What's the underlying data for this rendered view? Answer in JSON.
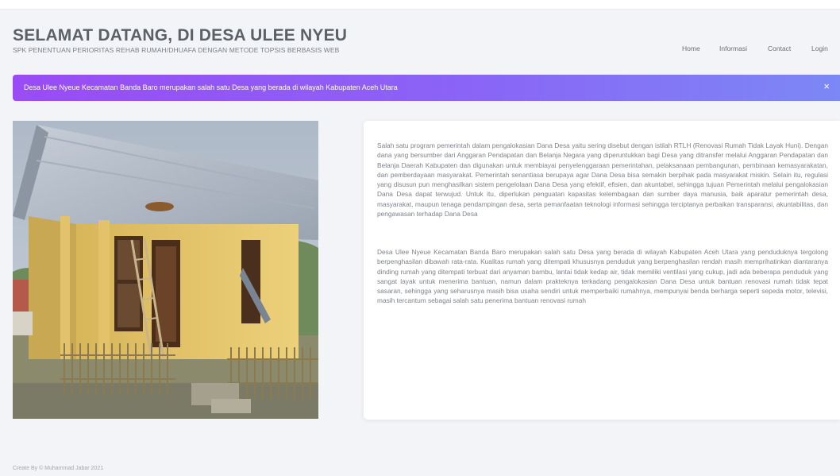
{
  "header": {
    "title": "SELAMAT DATANG, DI DESA ULEE NYEU",
    "subtitle": "SPK PENENTUAN PERIORITAS REHAB RUMAH/DHUAFA DENGAN METODE TOPSIS BERBASIS WEB"
  },
  "nav": {
    "home": "Home",
    "informasi": "Informasi",
    "contact": "Contact",
    "login": "Login"
  },
  "alert": {
    "text": "Desa Ulee Nyeue Kecamatan Banda Baro merupakan salah satu Desa yang berada di wilayah Kabupaten Aceh Utara",
    "close": "×",
    "gradient_start": "#9a4bf5",
    "gradient_end": "#7c88f5"
  },
  "photo": {
    "subject": "rehab house photo",
    "wall_color": "#e6c66a",
    "roof_color": "#b7bfc9"
  },
  "content": {
    "paragraph1": "Salah satu program pemerintah dalam pengalokasian Dana Desa yaitu sering disebut dengan istilah RTLH (Renovasi Rumah Tidak Layak Huni). Dengan dana yang bersumber dari Anggaran Pendapatan dan Belanja Negara yang diperuntukkan bagi Desa yang ditransfer melalui Anggaran Pendapatan dan Belanja Daerah Kabupaten dan digunakan untuk membiayai penyelenggaraan pemerintahan, pelaksanaan pembangunan, pembinaan kemasyarakatan, dan pemberdayaan masyarakat. Pemerintah senantiasa berupaya agar Dana Desa bisa semakin berpihak pada masyarakat miskin. Selain itu, regulasi yang disusun pun menghasilkan sistem pengelolaan Dana Desa yang efektif, efisien, dan akuntabel, sehingga tujuan Pemerintah melalui pengalokasian Dana Desa dapat terwujud. Untuk itu, diperlukan penguatan kapasitas kelembagaan dan sumber daya manusia, baik aparatur pemerintah desa, masyarakat, maupun tenaga pendampingan desa, serta pemanfaatan teknologi informasi sehingga terciptanya perbaikan transparansi, akuntabilitas, dan pengawasan terhadap Dana Desa",
    "paragraph2": "Desa Ulee Nyeue Kecamatan Banda Baro merupakan salah satu Desa yang berada di wilayah Kabupaten Aceh Utara yang penduduknya tergolong berpenghasilan dibawah rata-rata. Kualitas rumah yang ditempati khususnya penduduk yang berpenghasilan rendah masih memprihatinkan diantaranya dinding rumah yang ditempati terbuat dari anyaman bambu, lantai tidak kedap air, tidak memiliki ventilasi yang cukup, jadi ada beberapa penduduk yang sangat layak untuk menerima bantuan, namun dalam prakteknya terkadang pengalokasian Dana Desa untuk bantuan renovasi rumah tidak tepat sasaran, sehingga yang seharusnya masih bisa usaha sendiri untuk memperbaiki rumahnya, mempunyai benda berharga seperti sepeda motor, televisi, masih tercantum sebagai salah satu penerima bantuan renovasi rumah"
  },
  "footer": {
    "text": "Create By © Muhammad Jabar 2021"
  }
}
